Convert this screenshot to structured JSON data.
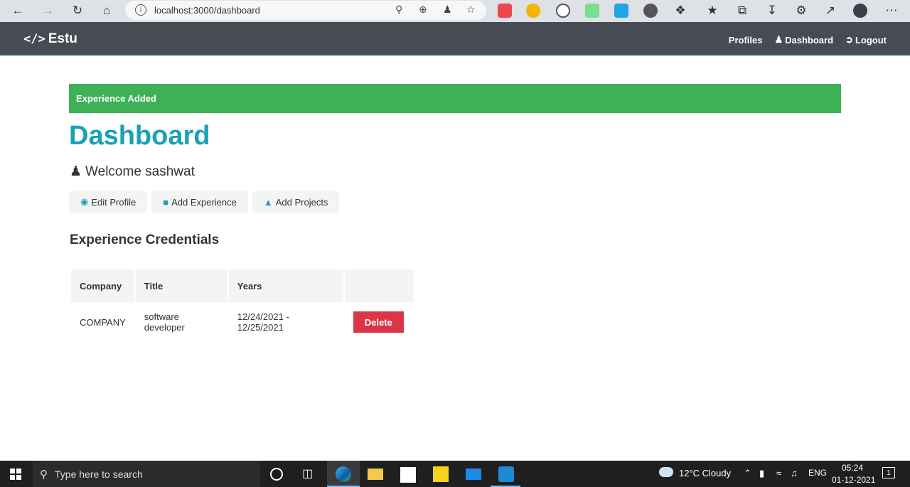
{
  "browser": {
    "url": "localhost:3000/dashboard"
  },
  "navbar": {
    "brand": "Estu",
    "links": [
      "Profiles",
      "Dashboard",
      "Logout"
    ]
  },
  "alert": {
    "text": "Experience Added",
    "color": "#3eb055"
  },
  "dashboard": {
    "title": "Dashboard",
    "welcome": "Welcome sashwat",
    "buttons": [
      "Edit Profile",
      "Add Experience",
      "Add Projects"
    ],
    "section_title": "Experience Credentials",
    "table": {
      "headers": [
        "Company",
        "Title",
        "Years",
        ""
      ],
      "rows": [
        {
          "company": "COMPANY",
          "title": "software developer",
          "years": "12/24/2021 - 12/25/2021",
          "action": "Delete"
        }
      ]
    }
  },
  "taskbar": {
    "search_placeholder": "Type here to search",
    "weather": "12°C  Cloudy",
    "lang": "ENG",
    "time": "05:24",
    "date": "01-12-2021",
    "notifications": "1"
  },
  "colors": {
    "accent": "#17a2b8",
    "danger": "#dc3545",
    "navbar": "#474b53"
  }
}
